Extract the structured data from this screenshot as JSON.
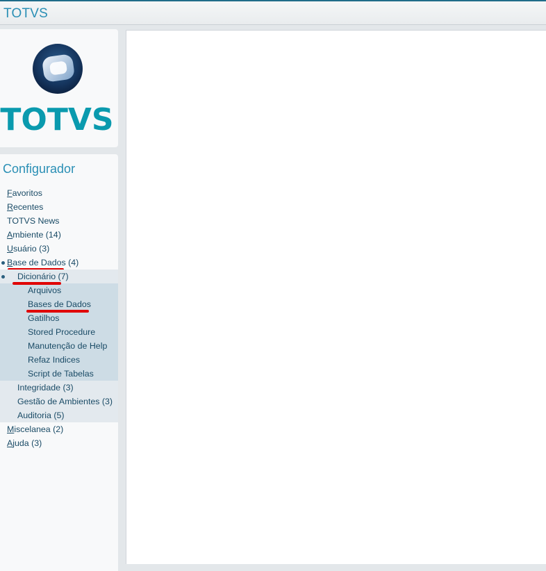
{
  "window": {
    "title": "TOTVS"
  },
  "logo": {
    "wordmark": "TOTVS"
  },
  "menu": {
    "title": "Configurador",
    "items": [
      {
        "label": "Favoritos",
        "accel": "F",
        "rest": "avoritos"
      },
      {
        "label": "Recentes",
        "accel": "R",
        "rest": "ecentes"
      },
      {
        "label": "TOTVS News"
      },
      {
        "label": "Ambiente (14)",
        "accel": "A",
        "rest": "mbiente (14)"
      },
      {
        "label": "Usuário (3)",
        "accel": "U",
        "rest": "suário (3)"
      },
      {
        "label": "Base de Dados (4)",
        "accel": "B",
        "rest": "ase de Dados (4)"
      },
      {
        "label": "Dicionário (7)"
      },
      {
        "label": "Arquivos"
      },
      {
        "label": "Bases de Dados"
      },
      {
        "label": "Gatilhos"
      },
      {
        "label": "Stored Procedure"
      },
      {
        "label": "Manutenção de Help"
      },
      {
        "label": "Refaz Indices"
      },
      {
        "label": "Script de Tabelas"
      },
      {
        "label": "Integridade (3)"
      },
      {
        "label": "Gestão de Ambientes (3)"
      },
      {
        "label": "Auditoria (5)"
      },
      {
        "label": "Miscelanea (2)",
        "accel": "M",
        "rest": "iscelanea (2)"
      },
      {
        "label": "Ajuda (3)",
        "accel": "A",
        "rest": "juda (3)"
      }
    ]
  },
  "annotations": {
    "underline_color": "#e00000"
  },
  "colors": {
    "accent": "#2a8fb5",
    "link": "#1a4b66",
    "logo_teal": "#0a9aae"
  }
}
